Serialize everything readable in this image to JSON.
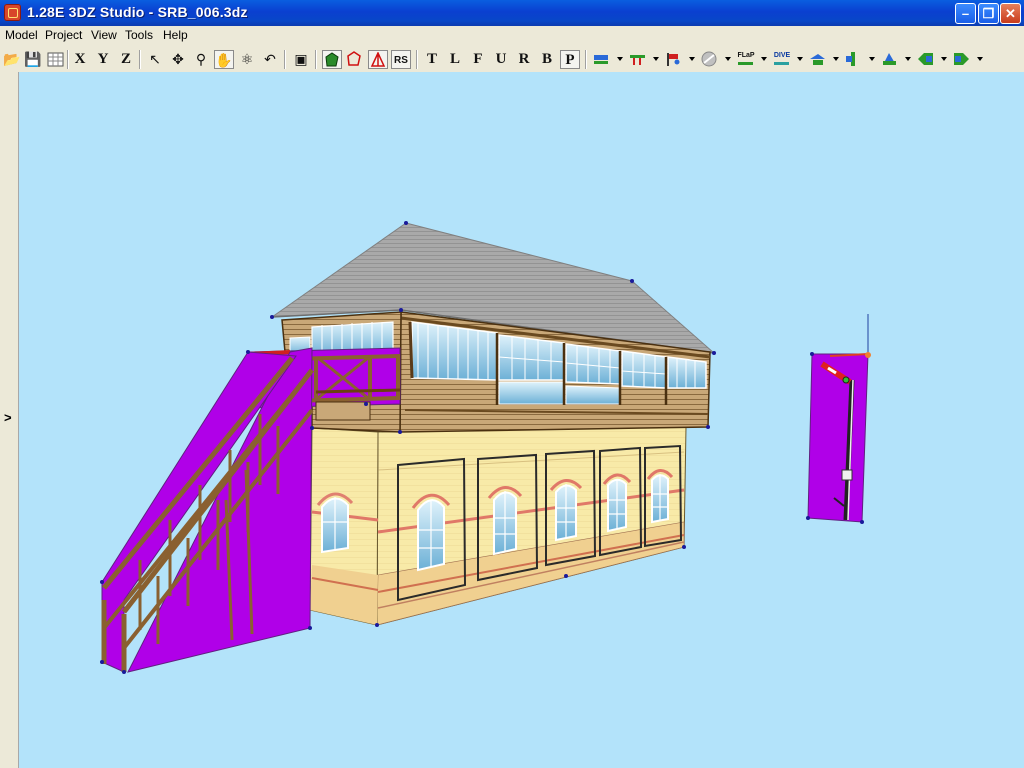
{
  "window": {
    "title": "1.28E 3DZ Studio - SRB_006.3dz"
  },
  "menu": [
    "Model",
    "Project",
    "View",
    "Tools",
    "Help"
  ],
  "toolbar_letters": [
    "T",
    "L",
    "F",
    "U",
    "R",
    "B",
    "P"
  ],
  "toolbar_axes": [
    "X",
    "Y",
    "Z"
  ],
  "toolbar_rs": "RS",
  "toolbar_labels": {
    "flap": "FLaP",
    "dive": "DIVE"
  },
  "viewport": {
    "background": "#b3e3fa",
    "expand_icon": ">"
  },
  "colors": {
    "accent": "#0a3fd0",
    "texture_missing": "#b000e8"
  }
}
